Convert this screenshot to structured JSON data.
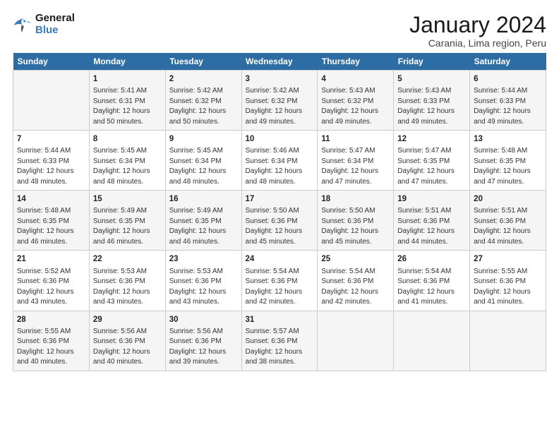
{
  "logo": {
    "text_general": "General",
    "text_blue": "Blue"
  },
  "title": "January 2024",
  "subtitle": "Carania, Lima region, Peru",
  "days_of_week": [
    "Sunday",
    "Monday",
    "Tuesday",
    "Wednesday",
    "Thursday",
    "Friday",
    "Saturday"
  ],
  "weeks": [
    [
      {
        "day": "",
        "info": ""
      },
      {
        "day": "1",
        "info": "Sunrise: 5:41 AM\nSunset: 6:31 PM\nDaylight: 12 hours\nand 50 minutes."
      },
      {
        "day": "2",
        "info": "Sunrise: 5:42 AM\nSunset: 6:32 PM\nDaylight: 12 hours\nand 50 minutes."
      },
      {
        "day": "3",
        "info": "Sunrise: 5:42 AM\nSunset: 6:32 PM\nDaylight: 12 hours\nand 49 minutes."
      },
      {
        "day": "4",
        "info": "Sunrise: 5:43 AM\nSunset: 6:32 PM\nDaylight: 12 hours\nand 49 minutes."
      },
      {
        "day": "5",
        "info": "Sunrise: 5:43 AM\nSunset: 6:33 PM\nDaylight: 12 hours\nand 49 minutes."
      },
      {
        "day": "6",
        "info": "Sunrise: 5:44 AM\nSunset: 6:33 PM\nDaylight: 12 hours\nand 49 minutes."
      }
    ],
    [
      {
        "day": "7",
        "info": "Sunrise: 5:44 AM\nSunset: 6:33 PM\nDaylight: 12 hours\nand 48 minutes."
      },
      {
        "day": "8",
        "info": "Sunrise: 5:45 AM\nSunset: 6:34 PM\nDaylight: 12 hours\nand 48 minutes."
      },
      {
        "day": "9",
        "info": "Sunrise: 5:45 AM\nSunset: 6:34 PM\nDaylight: 12 hours\nand 48 minutes."
      },
      {
        "day": "10",
        "info": "Sunrise: 5:46 AM\nSunset: 6:34 PM\nDaylight: 12 hours\nand 48 minutes."
      },
      {
        "day": "11",
        "info": "Sunrise: 5:47 AM\nSunset: 6:34 PM\nDaylight: 12 hours\nand 47 minutes."
      },
      {
        "day": "12",
        "info": "Sunrise: 5:47 AM\nSunset: 6:35 PM\nDaylight: 12 hours\nand 47 minutes."
      },
      {
        "day": "13",
        "info": "Sunrise: 5:48 AM\nSunset: 6:35 PM\nDaylight: 12 hours\nand 47 minutes."
      }
    ],
    [
      {
        "day": "14",
        "info": "Sunrise: 5:48 AM\nSunset: 6:35 PM\nDaylight: 12 hours\nand 46 minutes."
      },
      {
        "day": "15",
        "info": "Sunrise: 5:49 AM\nSunset: 6:35 PM\nDaylight: 12 hours\nand 46 minutes."
      },
      {
        "day": "16",
        "info": "Sunrise: 5:49 AM\nSunset: 6:35 PM\nDaylight: 12 hours\nand 46 minutes."
      },
      {
        "day": "17",
        "info": "Sunrise: 5:50 AM\nSunset: 6:36 PM\nDaylight: 12 hours\nand 45 minutes."
      },
      {
        "day": "18",
        "info": "Sunrise: 5:50 AM\nSunset: 6:36 PM\nDaylight: 12 hours\nand 45 minutes."
      },
      {
        "day": "19",
        "info": "Sunrise: 5:51 AM\nSunset: 6:36 PM\nDaylight: 12 hours\nand 44 minutes."
      },
      {
        "day": "20",
        "info": "Sunrise: 5:51 AM\nSunset: 6:36 PM\nDaylight: 12 hours\nand 44 minutes."
      }
    ],
    [
      {
        "day": "21",
        "info": "Sunrise: 5:52 AM\nSunset: 6:36 PM\nDaylight: 12 hours\nand 43 minutes."
      },
      {
        "day": "22",
        "info": "Sunrise: 5:53 AM\nSunset: 6:36 PM\nDaylight: 12 hours\nand 43 minutes."
      },
      {
        "day": "23",
        "info": "Sunrise: 5:53 AM\nSunset: 6:36 PM\nDaylight: 12 hours\nand 43 minutes."
      },
      {
        "day": "24",
        "info": "Sunrise: 5:54 AM\nSunset: 6:36 PM\nDaylight: 12 hours\nand 42 minutes."
      },
      {
        "day": "25",
        "info": "Sunrise: 5:54 AM\nSunset: 6:36 PM\nDaylight: 12 hours\nand 42 minutes."
      },
      {
        "day": "26",
        "info": "Sunrise: 5:54 AM\nSunset: 6:36 PM\nDaylight: 12 hours\nand 41 minutes."
      },
      {
        "day": "27",
        "info": "Sunrise: 5:55 AM\nSunset: 6:36 PM\nDaylight: 12 hours\nand 41 minutes."
      }
    ],
    [
      {
        "day": "28",
        "info": "Sunrise: 5:55 AM\nSunset: 6:36 PM\nDaylight: 12 hours\nand 40 minutes."
      },
      {
        "day": "29",
        "info": "Sunrise: 5:56 AM\nSunset: 6:36 PM\nDaylight: 12 hours\nand 40 minutes."
      },
      {
        "day": "30",
        "info": "Sunrise: 5:56 AM\nSunset: 6:36 PM\nDaylight: 12 hours\nand 39 minutes."
      },
      {
        "day": "31",
        "info": "Sunrise: 5:57 AM\nSunset: 6:36 PM\nDaylight: 12 hours\nand 38 minutes."
      },
      {
        "day": "",
        "info": ""
      },
      {
        "day": "",
        "info": ""
      },
      {
        "day": "",
        "info": ""
      }
    ]
  ]
}
